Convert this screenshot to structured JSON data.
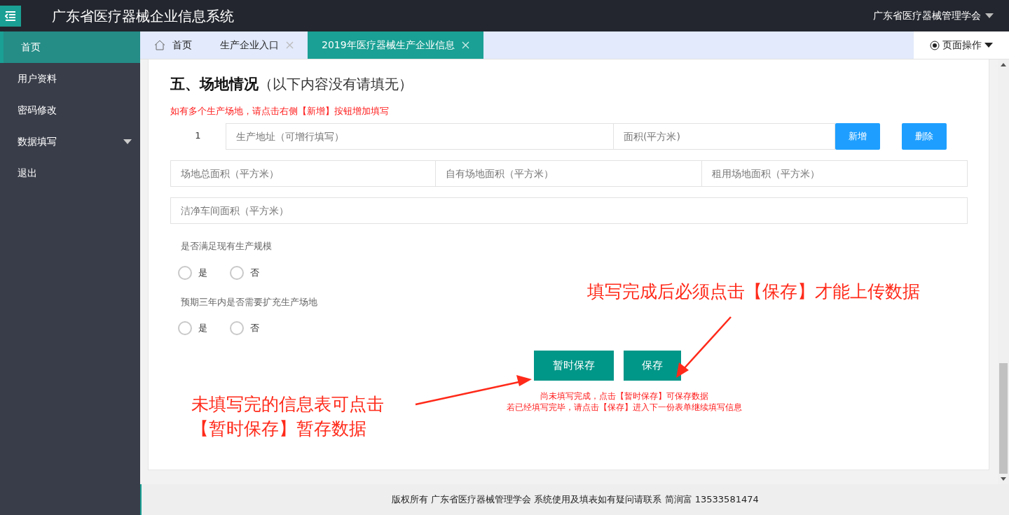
{
  "header": {
    "title": "广东省医疗器械企业信息系统",
    "user": "广东省医疗器械管理学会"
  },
  "sidebar": {
    "items": [
      {
        "label": "首页",
        "selected": true
      },
      {
        "label": "用户资料",
        "selected": false
      },
      {
        "label": "密码修改",
        "selected": false
      },
      {
        "label": "数据填写",
        "selected": false,
        "expandable": true
      },
      {
        "label": "退出",
        "selected": false
      }
    ]
  },
  "tabs": [
    {
      "label": "首页",
      "kind": "home",
      "selected": false
    },
    {
      "label": "生产企业入口",
      "kind": "closable",
      "selected": false
    },
    {
      "label": "2019年医疗器械生产企业信息",
      "kind": "closable",
      "selected": true
    }
  ],
  "page_actions": "页面操作",
  "section": {
    "title": "五、场地情况",
    "subtitle": "（以下内容没有请填无）",
    "note": "如有多个生产场地，请点击右侧【新增】按钮增加填写",
    "site_rows": [
      {
        "index": "1",
        "address_placeholder": "生产地址（可增行填写）",
        "area_placeholder": "面积(平方米)"
      }
    ],
    "row_buttons": [
      "新增",
      "删除"
    ],
    "area_fields": [
      {
        "placeholder": "场地总面积（平方米）"
      },
      {
        "placeholder": "自有场地面积（平方米）"
      },
      {
        "placeholder": "租用场地面积（平方米）"
      }
    ],
    "clean_field": {
      "placeholder": "洁净车间面积（平方米）"
    },
    "questions": [
      {
        "label": "是否满足现有生产规模",
        "options": [
          {
            "label": "是",
            "selected": false
          },
          {
            "label": "否",
            "selected": false
          }
        ]
      },
      {
        "label": "预期三年内是否需要扩充生产场地",
        "options": [
          {
            "label": "是",
            "selected": false
          },
          {
            "label": "否",
            "selected": false
          }
        ]
      }
    ],
    "buttons": [
      "暂时保存",
      "保存"
    ],
    "hints": [
      "尚未填写完成，点击【暂时保存】可保存数据",
      "若已经填写完毕，请点击【保存】进入下一份表单继续填写信息"
    ]
  },
  "annotations": [
    "填写完成后必须点击【保存】才能上传数据",
    "未填写完的信息表可点击【暂时保存】暂存数据"
  ],
  "footer": "版权所有 广东省医疗器械管理学会 系统使用及填表如有疑问请联系 简润富 13533581474"
}
